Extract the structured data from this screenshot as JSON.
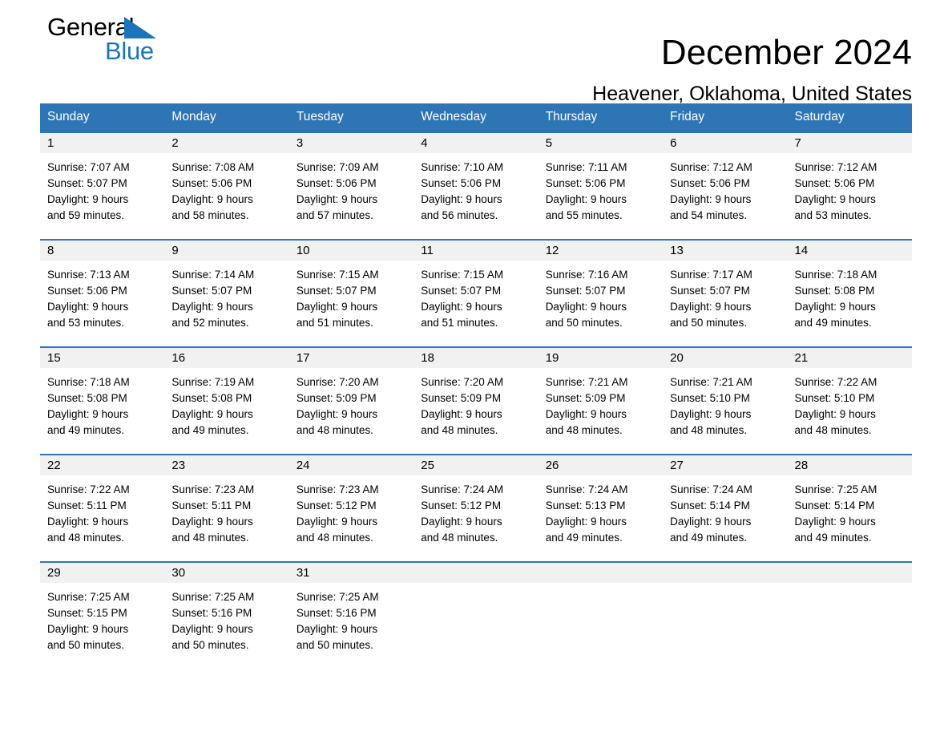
{
  "brand": {
    "name_part1": "General",
    "name_part2": "Blue",
    "color_black": "#000000",
    "color_blue": "#1b75bb"
  },
  "header": {
    "title": "December 2024",
    "subtitle": "Heavener, Oklahoma, United States"
  },
  "theme": {
    "header_bg": "#2e75b6",
    "header_text": "#ffffff",
    "daynum_bg": "#f1f1f1",
    "cell_bg": "#ffffff",
    "border": "#2e75b6"
  },
  "weekday_headers": [
    "Sunday",
    "Monday",
    "Tuesday",
    "Wednesday",
    "Thursday",
    "Friday",
    "Saturday"
  ],
  "labels": {
    "sunrise_prefix": "Sunrise:",
    "sunset_prefix": "Sunset:",
    "daylight_prefix": "Daylight:"
  },
  "weeks": [
    [
      {
        "day": "1",
        "sunrise": "Sunrise: 7:07 AM",
        "sunset": "Sunset: 5:07 PM",
        "daylight_l1": "Daylight: 9 hours",
        "daylight_l2": "and 59 minutes."
      },
      {
        "day": "2",
        "sunrise": "Sunrise: 7:08 AM",
        "sunset": "Sunset: 5:06 PM",
        "daylight_l1": "Daylight: 9 hours",
        "daylight_l2": "and 58 minutes."
      },
      {
        "day": "3",
        "sunrise": "Sunrise: 7:09 AM",
        "sunset": "Sunset: 5:06 PM",
        "daylight_l1": "Daylight: 9 hours",
        "daylight_l2": "and 57 minutes."
      },
      {
        "day": "4",
        "sunrise": "Sunrise: 7:10 AM",
        "sunset": "Sunset: 5:06 PM",
        "daylight_l1": "Daylight: 9 hours",
        "daylight_l2": "and 56 minutes."
      },
      {
        "day": "5",
        "sunrise": "Sunrise: 7:11 AM",
        "sunset": "Sunset: 5:06 PM",
        "daylight_l1": "Daylight: 9 hours",
        "daylight_l2": "and 55 minutes."
      },
      {
        "day": "6",
        "sunrise": "Sunrise: 7:12 AM",
        "sunset": "Sunset: 5:06 PM",
        "daylight_l1": "Daylight: 9 hours",
        "daylight_l2": "and 54 minutes."
      },
      {
        "day": "7",
        "sunrise": "Sunrise: 7:12 AM",
        "sunset": "Sunset: 5:06 PM",
        "daylight_l1": "Daylight: 9 hours",
        "daylight_l2": "and 53 minutes."
      }
    ],
    [
      {
        "day": "8",
        "sunrise": "Sunrise: 7:13 AM",
        "sunset": "Sunset: 5:06 PM",
        "daylight_l1": "Daylight: 9 hours",
        "daylight_l2": "and 53 minutes."
      },
      {
        "day": "9",
        "sunrise": "Sunrise: 7:14 AM",
        "sunset": "Sunset: 5:07 PM",
        "daylight_l1": "Daylight: 9 hours",
        "daylight_l2": "and 52 minutes."
      },
      {
        "day": "10",
        "sunrise": "Sunrise: 7:15 AM",
        "sunset": "Sunset: 5:07 PM",
        "daylight_l1": "Daylight: 9 hours",
        "daylight_l2": "and 51 minutes."
      },
      {
        "day": "11",
        "sunrise": "Sunrise: 7:15 AM",
        "sunset": "Sunset: 5:07 PM",
        "daylight_l1": "Daylight: 9 hours",
        "daylight_l2": "and 51 minutes."
      },
      {
        "day": "12",
        "sunrise": "Sunrise: 7:16 AM",
        "sunset": "Sunset: 5:07 PM",
        "daylight_l1": "Daylight: 9 hours",
        "daylight_l2": "and 50 minutes."
      },
      {
        "day": "13",
        "sunrise": "Sunrise: 7:17 AM",
        "sunset": "Sunset: 5:07 PM",
        "daylight_l1": "Daylight: 9 hours",
        "daylight_l2": "and 50 minutes."
      },
      {
        "day": "14",
        "sunrise": "Sunrise: 7:18 AM",
        "sunset": "Sunset: 5:08 PM",
        "daylight_l1": "Daylight: 9 hours",
        "daylight_l2": "and 49 minutes."
      }
    ],
    [
      {
        "day": "15",
        "sunrise": "Sunrise: 7:18 AM",
        "sunset": "Sunset: 5:08 PM",
        "daylight_l1": "Daylight: 9 hours",
        "daylight_l2": "and 49 minutes."
      },
      {
        "day": "16",
        "sunrise": "Sunrise: 7:19 AM",
        "sunset": "Sunset: 5:08 PM",
        "daylight_l1": "Daylight: 9 hours",
        "daylight_l2": "and 49 minutes."
      },
      {
        "day": "17",
        "sunrise": "Sunrise: 7:20 AM",
        "sunset": "Sunset: 5:09 PM",
        "daylight_l1": "Daylight: 9 hours",
        "daylight_l2": "and 48 minutes."
      },
      {
        "day": "18",
        "sunrise": "Sunrise: 7:20 AM",
        "sunset": "Sunset: 5:09 PM",
        "daylight_l1": "Daylight: 9 hours",
        "daylight_l2": "and 48 minutes."
      },
      {
        "day": "19",
        "sunrise": "Sunrise: 7:21 AM",
        "sunset": "Sunset: 5:09 PM",
        "daylight_l1": "Daylight: 9 hours",
        "daylight_l2": "and 48 minutes."
      },
      {
        "day": "20",
        "sunrise": "Sunrise: 7:21 AM",
        "sunset": "Sunset: 5:10 PM",
        "daylight_l1": "Daylight: 9 hours",
        "daylight_l2": "and 48 minutes."
      },
      {
        "day": "21",
        "sunrise": "Sunrise: 7:22 AM",
        "sunset": "Sunset: 5:10 PM",
        "daylight_l1": "Daylight: 9 hours",
        "daylight_l2": "and 48 minutes."
      }
    ],
    [
      {
        "day": "22",
        "sunrise": "Sunrise: 7:22 AM",
        "sunset": "Sunset: 5:11 PM",
        "daylight_l1": "Daylight: 9 hours",
        "daylight_l2": "and 48 minutes."
      },
      {
        "day": "23",
        "sunrise": "Sunrise: 7:23 AM",
        "sunset": "Sunset: 5:11 PM",
        "daylight_l1": "Daylight: 9 hours",
        "daylight_l2": "and 48 minutes."
      },
      {
        "day": "24",
        "sunrise": "Sunrise: 7:23 AM",
        "sunset": "Sunset: 5:12 PM",
        "daylight_l1": "Daylight: 9 hours",
        "daylight_l2": "and 48 minutes."
      },
      {
        "day": "25",
        "sunrise": "Sunrise: 7:24 AM",
        "sunset": "Sunset: 5:12 PM",
        "daylight_l1": "Daylight: 9 hours",
        "daylight_l2": "and 48 minutes."
      },
      {
        "day": "26",
        "sunrise": "Sunrise: 7:24 AM",
        "sunset": "Sunset: 5:13 PM",
        "daylight_l1": "Daylight: 9 hours",
        "daylight_l2": "and 49 minutes."
      },
      {
        "day": "27",
        "sunrise": "Sunrise: 7:24 AM",
        "sunset": "Sunset: 5:14 PM",
        "daylight_l1": "Daylight: 9 hours",
        "daylight_l2": "and 49 minutes."
      },
      {
        "day": "28",
        "sunrise": "Sunrise: 7:25 AM",
        "sunset": "Sunset: 5:14 PM",
        "daylight_l1": "Daylight: 9 hours",
        "daylight_l2": "and 49 minutes."
      }
    ],
    [
      {
        "day": "29",
        "sunrise": "Sunrise: 7:25 AM",
        "sunset": "Sunset: 5:15 PM",
        "daylight_l1": "Daylight: 9 hours",
        "daylight_l2": "and 50 minutes."
      },
      {
        "day": "30",
        "sunrise": "Sunrise: 7:25 AM",
        "sunset": "Sunset: 5:16 PM",
        "daylight_l1": "Daylight: 9 hours",
        "daylight_l2": "and 50 minutes."
      },
      {
        "day": "31",
        "sunrise": "Sunrise: 7:25 AM",
        "sunset": "Sunset: 5:16 PM",
        "daylight_l1": "Daylight: 9 hours",
        "daylight_l2": "and 50 minutes."
      },
      {
        "day": "",
        "sunrise": "",
        "sunset": "",
        "daylight_l1": "",
        "daylight_l2": ""
      },
      {
        "day": "",
        "sunrise": "",
        "sunset": "",
        "daylight_l1": "",
        "daylight_l2": ""
      },
      {
        "day": "",
        "sunrise": "",
        "sunset": "",
        "daylight_l1": "",
        "daylight_l2": ""
      },
      {
        "day": "",
        "sunrise": "",
        "sunset": "",
        "daylight_l1": "",
        "daylight_l2": ""
      }
    ]
  ]
}
